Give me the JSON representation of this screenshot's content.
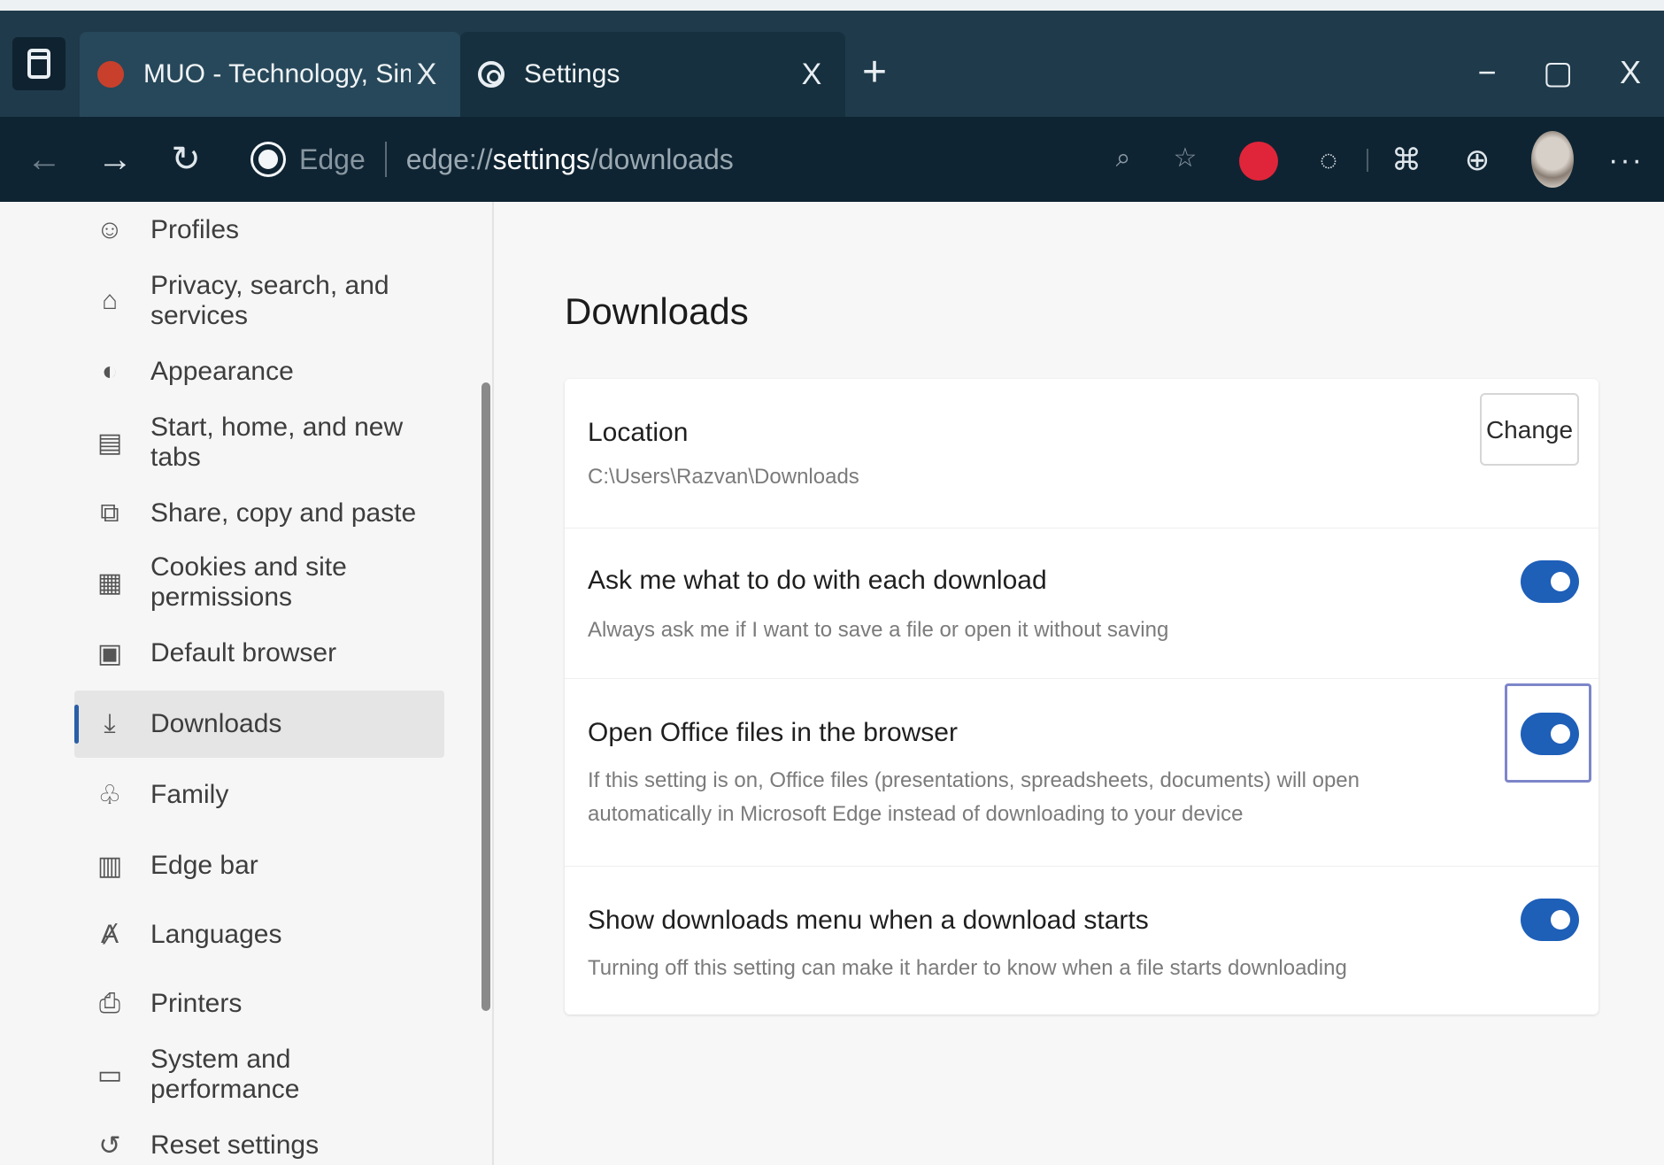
{
  "browser": {
    "tabs": [
      {
        "title": "MUO - Technology, Simplified.",
        "close": "X"
      },
      {
        "title": "Settings",
        "close": "X"
      }
    ],
    "new_tab": "+",
    "window_controls": {
      "minimize": "−",
      "maximize": "▢",
      "close": "X"
    },
    "nav": {
      "back": "←",
      "forward": "→",
      "reload": "↻"
    },
    "address": {
      "label": "Edge",
      "url_prefix": "edge://",
      "url_strong": "settings",
      "url_suffix": "/downloads"
    },
    "more": "···"
  },
  "sidebar": {
    "items": [
      {
        "label": "Profiles",
        "icon": "profile-icon",
        "glyph": "☺"
      },
      {
        "label": "Privacy, search, and services",
        "icon": "lock-icon",
        "glyph": "🔒"
      },
      {
        "label": "Appearance",
        "icon": "appearance-icon",
        "glyph": "◐"
      },
      {
        "label": "Start, home, and new tabs",
        "icon": "home-icon",
        "glyph": "▤"
      },
      {
        "label": "Share, copy and paste",
        "icon": "share-icon",
        "glyph": "⧉"
      },
      {
        "label": "Cookies and site permissions",
        "icon": "cookie-icon",
        "glyph": "▦"
      },
      {
        "label": "Default browser",
        "icon": "browser-icon",
        "glyph": "▣"
      },
      {
        "label": "Downloads",
        "icon": "download-icon",
        "glyph": "⤓",
        "selected": true
      },
      {
        "label": "Family",
        "icon": "family-icon",
        "glyph": "♧"
      },
      {
        "label": "Edge bar",
        "icon": "edge-bar-icon",
        "glyph": "▥"
      },
      {
        "label": "Languages",
        "icon": "language-icon",
        "glyph": "Ⱥ"
      },
      {
        "label": "Printers",
        "icon": "printer-icon",
        "glyph": "⎙"
      },
      {
        "label": "System and performance",
        "icon": "system-icon",
        "glyph": "▭"
      },
      {
        "label": "Reset settings",
        "icon": "reset-icon",
        "glyph": "↺"
      }
    ]
  },
  "main": {
    "title": "Downloads",
    "location": {
      "title": "Location",
      "path": "C:\\Users\\Razvan\\Downloads",
      "change_label": "Change"
    },
    "settings": [
      {
        "title": "Ask me what to do with each download",
        "desc": "Always ask me if I want to save a file or open it without saving",
        "enabled": true
      },
      {
        "title": "Open Office files in the browser",
        "desc": "If this setting is on, Office files (presentations, spreadsheets, documents) will open automatically in Microsoft Edge instead of downloading to your device",
        "enabled": true
      },
      {
        "title": "Show downloads menu when a download starts",
        "desc": "Turning off this setting can make it harder to know when a file starts downloading",
        "enabled": true
      }
    ]
  },
  "colors": {
    "accent": "#1e5fb8",
    "titlebar": "#1f3a4a",
    "toolbar": "#0f2432",
    "extension_red": "#e0253a"
  }
}
